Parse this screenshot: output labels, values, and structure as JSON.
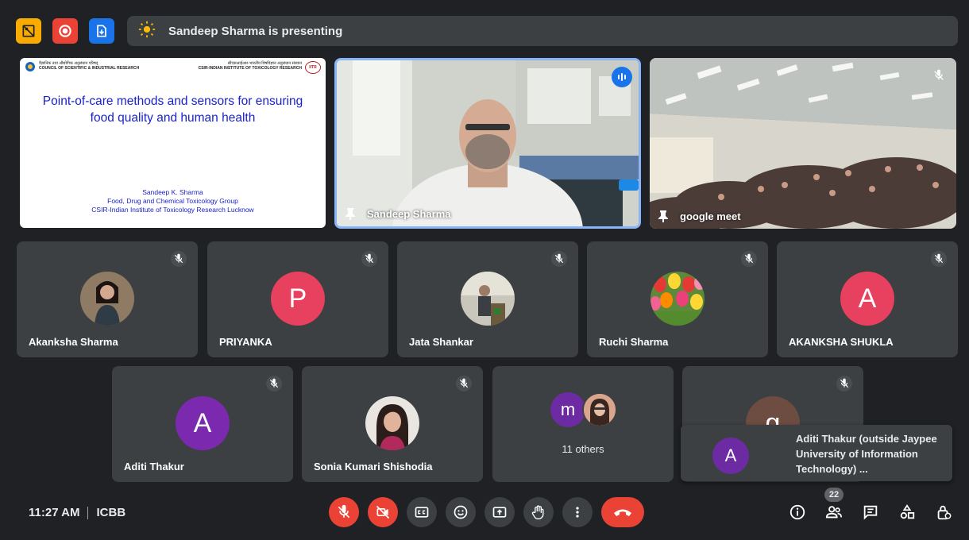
{
  "topbar": {
    "presenting_text": "Sandeep Sharma is presenting"
  },
  "slide": {
    "header_left_line1": "वैज्ञानिक तथा औद्योगिक अनुसंधान परिषद्",
    "header_left_line2": "COUNCIL OF SCIENTIFIC & INDUSTRIAL RESEARCH",
    "header_right_line1": "सीएसआईआर-भारतीय विषविज्ञान अनुसंधान संस्थान",
    "header_right_line2": "CSIR-INDIAN INSTITUTE OF TOXICOLOGY RESEARCH",
    "header_logo_text": "IITR",
    "title_line1": "Point-of-care methods and sensors for ensuring",
    "title_line2": "food quality and human health",
    "author": "Sandeep K. Sharma",
    "group": "Food, Drug and Chemical Toxicology Group",
    "institute": "CSIR-Indian Institute of Toxicology Research Lucknow"
  },
  "main_tiles": {
    "presenter_name": "Sandeep Sharma",
    "room_name": "google meet"
  },
  "participants_row1": [
    {
      "name": "Akanksha Sharma",
      "initial": "",
      "color": "#8a6a5a"
    },
    {
      "name": "PRIYANKA",
      "initial": "P",
      "color": "#e8405f"
    },
    {
      "name": "Jata Shankar",
      "initial": "",
      "color": "#b8b0a0"
    },
    {
      "name": "Ruchi Sharma",
      "initial": "",
      "color": "#e05a3a"
    },
    {
      "name": "AKANKSHA SHUKLA",
      "initial": "A",
      "color": "#e8405f"
    }
  ],
  "participants_row2": [
    {
      "name": "Aditi Thakur",
      "initial": "A",
      "color": "#7b2ab0"
    },
    {
      "name": "Sonia Kumari Shishodia",
      "initial": "",
      "color": "#c08080"
    }
  ],
  "others": {
    "initial": "m",
    "label": "11 others"
  },
  "hidden_tile": {
    "initial": "g",
    "color": "#6d4c41"
  },
  "notification": {
    "initial": "A",
    "text": "Aditi Thakur (outside Jaypee University of Information Technology) ..."
  },
  "bottombar": {
    "time": "11:27 AM",
    "meeting_code": "ICBB",
    "participant_count": "22"
  },
  "colors": {
    "background": "#202124",
    "tile": "#3c4043",
    "accent": "#8ab4f8",
    "danger": "#ea4335",
    "speaking": "#1a73e8"
  }
}
